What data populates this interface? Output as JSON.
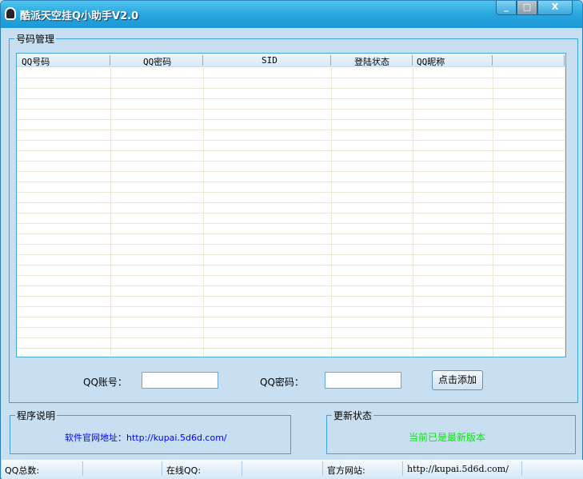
{
  "window": {
    "title": "酷派天空挂Q小助手V2.0",
    "minimize": "_",
    "close": "X"
  },
  "accounts": {
    "legend": "号码管理",
    "columns": [
      "QQ号码",
      "QQ密码",
      "SID",
      "登陆状态",
      "QQ昵称",
      ""
    ]
  },
  "form": {
    "account_label": "QQ账号：",
    "account_value": "",
    "password_label": "QQ密码：",
    "password_value": "",
    "add_button": "点击添加"
  },
  "info": {
    "legend": "程序说明",
    "text": "软件官网地址：http://kupai.5d6d.com/",
    "text_color": "#0000ff"
  },
  "update": {
    "legend": "更新状态",
    "text": "当前已是最新版本",
    "text_color": "#00ee00"
  },
  "statusbar": {
    "total_label": "QQ总数:",
    "total_value": "",
    "online_label": "在线QQ:",
    "online_value": "",
    "site_label": "官方网站:",
    "site_value": "http://kupai.5d6d.com/"
  }
}
